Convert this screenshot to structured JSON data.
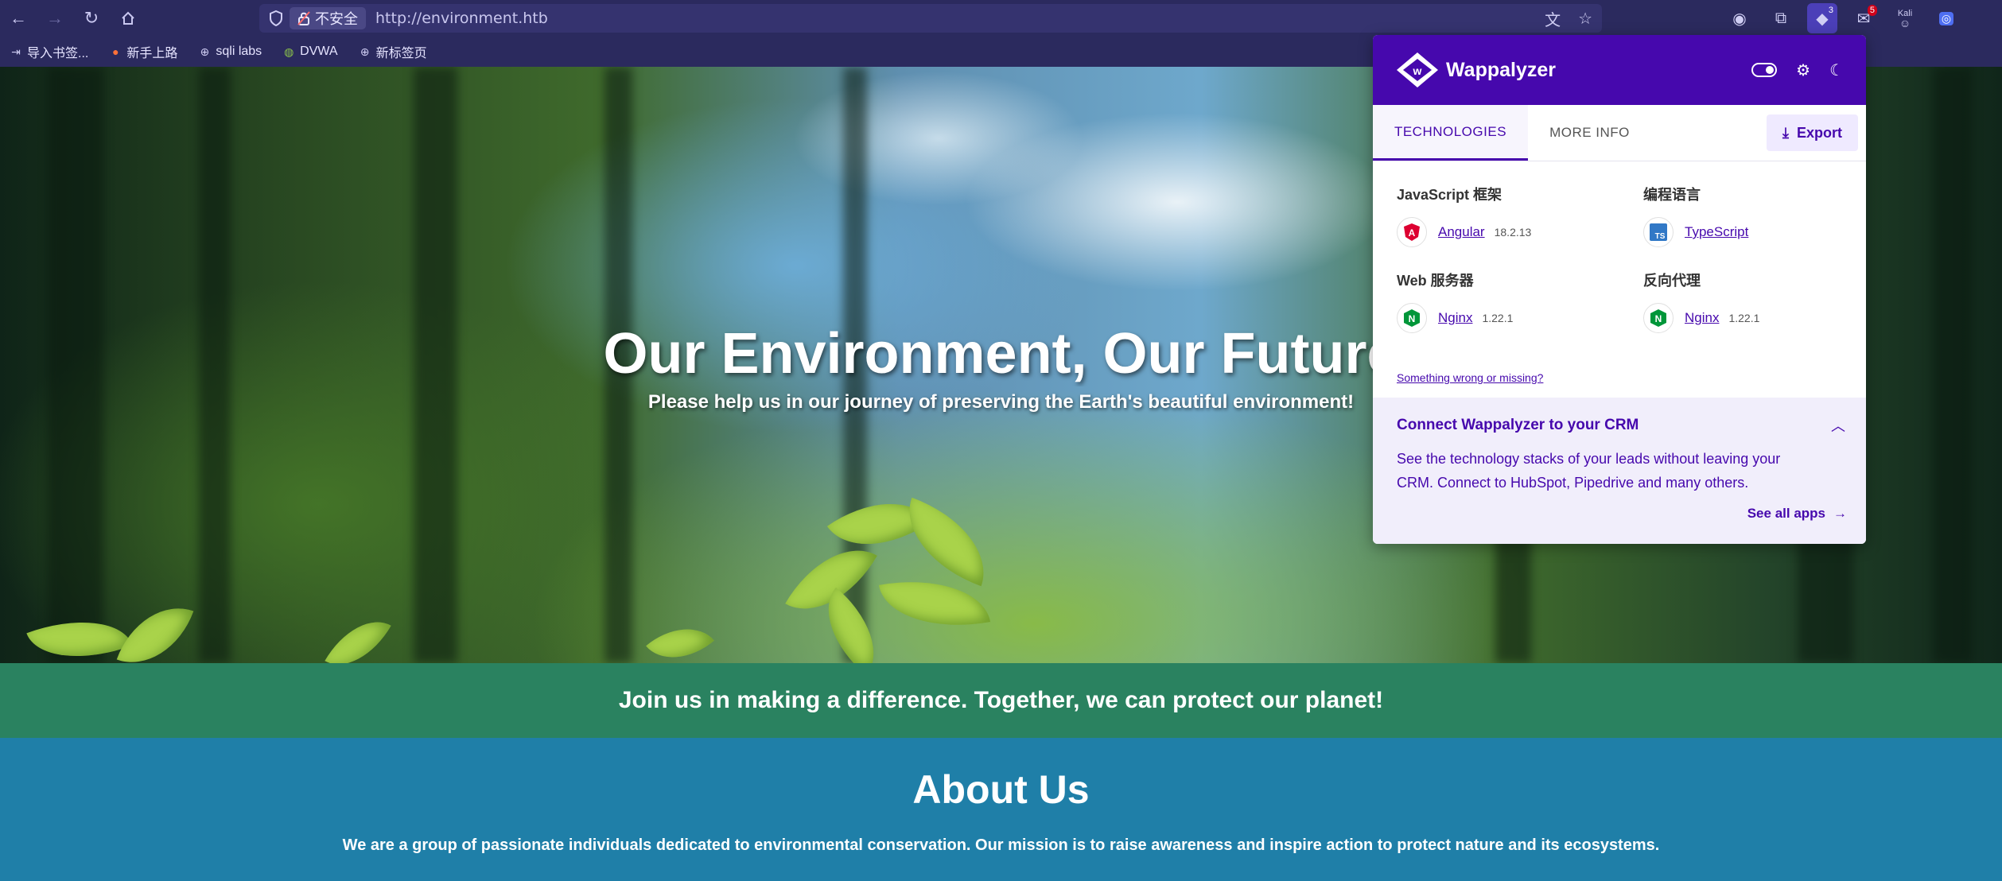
{
  "browser": {
    "url": "http://environment.htb",
    "insecure_label": "不安全",
    "bookmarks": [
      {
        "label": "导入书签...",
        "icon": "import-icon"
      },
      {
        "label": "新手上路",
        "icon": "firefox-icon"
      },
      {
        "label": "sqli labs",
        "icon": "globe-icon"
      },
      {
        "label": "DVWA",
        "icon": "dvwa-icon"
      },
      {
        "label": "新标签页",
        "icon": "globe-icon"
      }
    ],
    "extensions": {
      "wappalyzer_badge": "3",
      "mail_badge": "5",
      "kali_label": "Kali"
    }
  },
  "page": {
    "hero_title": "Our Environment, Our Future",
    "hero_subtitle": "Please help us in our journey of preserving the Earth's beautiful environment!",
    "band_text": "Join us in making a difference. Together, we can protect our planet!",
    "about_title": "About Us",
    "about_text": "We are a group of passionate individuals dedicated to environmental conservation. Our mission is to raise awareness and inspire action to protect nature and its ecosystems."
  },
  "wappalyzer": {
    "brand": "Wappalyzer",
    "tabs": [
      "TECHNOLOGIES",
      "MORE INFO"
    ],
    "export_label": "Export",
    "categories": [
      {
        "title": "JavaScript 框架",
        "tech": "Angular",
        "version": "18.2.13",
        "icon": "angular-icon"
      },
      {
        "title": "编程语言",
        "tech": "TypeScript",
        "version": "",
        "icon": "typescript-icon"
      },
      {
        "title": "Web 服务器",
        "tech": "Nginx",
        "version": "1.22.1",
        "icon": "nginx-icon"
      },
      {
        "title": "反向代理",
        "tech": "Nginx",
        "version": "1.22.1",
        "icon": "nginx-icon"
      }
    ],
    "wrong_link": "Something wrong or missing?",
    "crm": {
      "title": "Connect Wappalyzer to your CRM",
      "text": "See the technology stacks of your leads without leaving your CRM. Connect to HubSpot, Pipedrive and many others.",
      "link": "See all apps"
    }
  },
  "colors": {
    "chrome": "#2b2a5e",
    "wappalyzer_purple": "#4608ad",
    "band_green": "#2a8260",
    "about_blue": "#1f7fa8"
  }
}
